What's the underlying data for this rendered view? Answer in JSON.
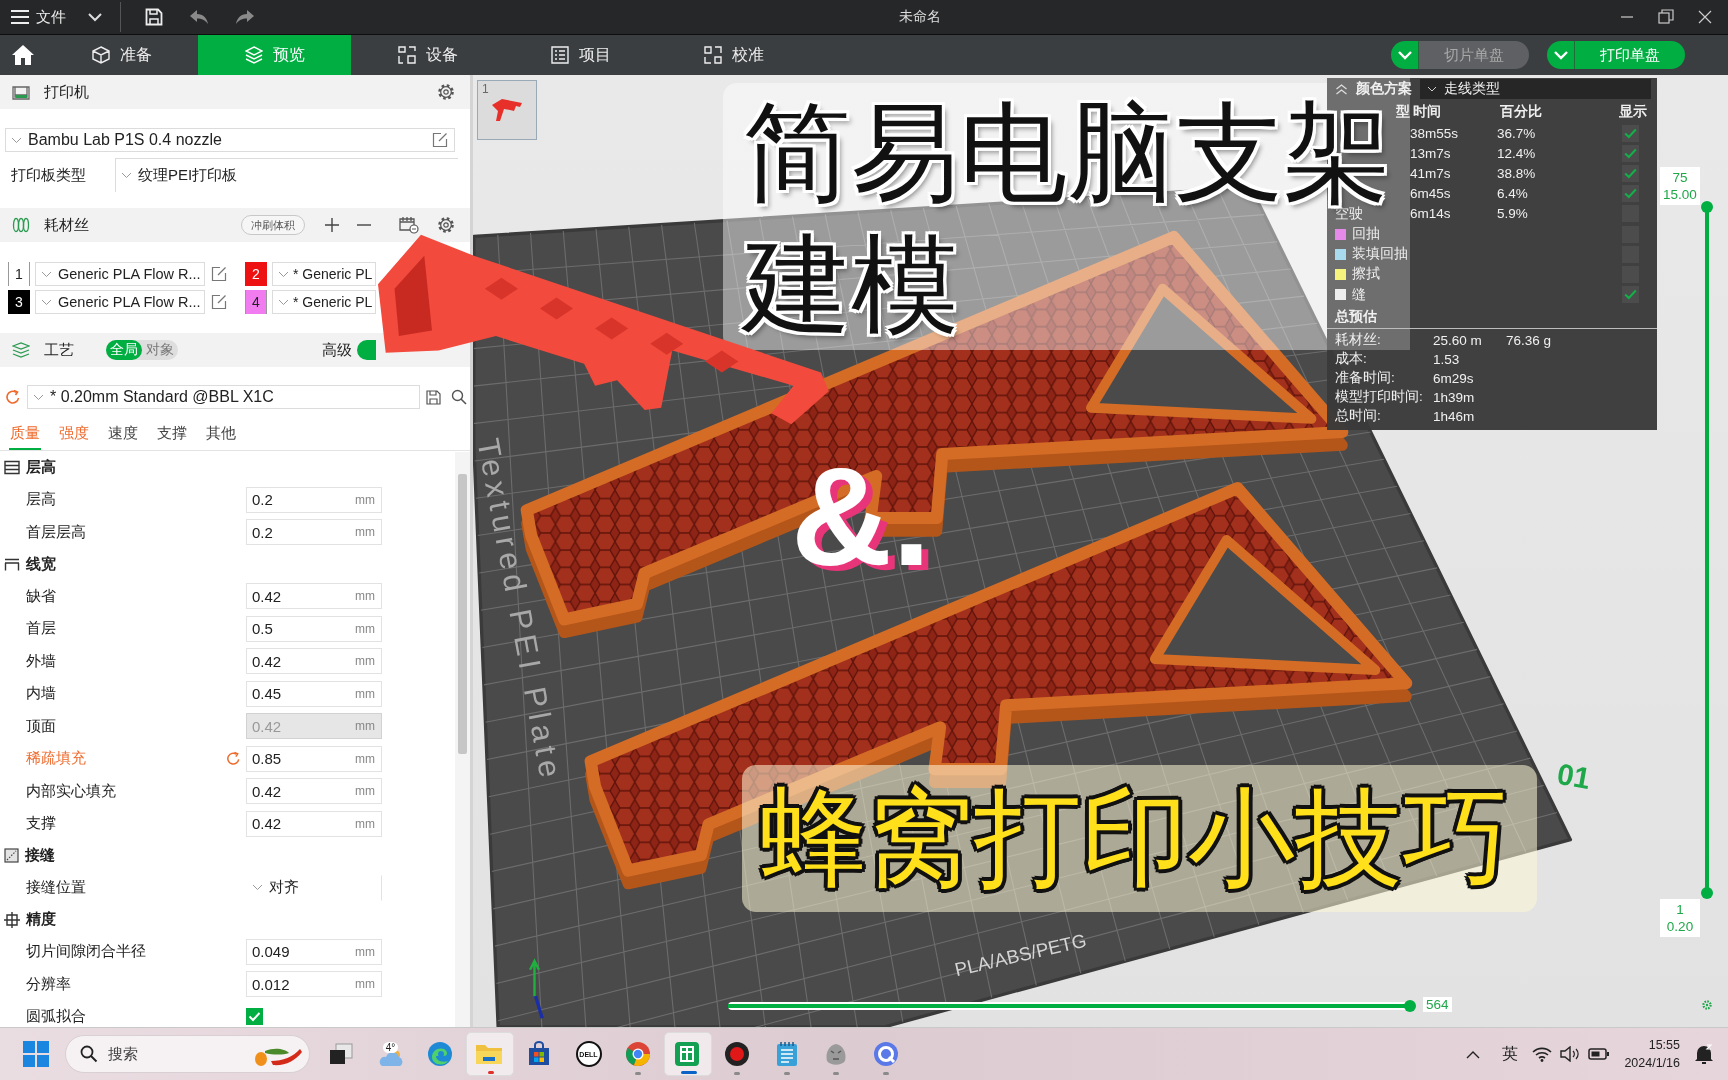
{
  "title_bar": {
    "menu": "文件",
    "title": "未命名"
  },
  "nav": {
    "tabs": [
      {
        "label": "准备",
        "selected": false
      },
      {
        "label": "预览",
        "selected": true
      },
      {
        "label": "设备",
        "selected": false
      },
      {
        "label": "项目",
        "selected": false
      },
      {
        "label": "校准",
        "selected": false
      }
    ],
    "actions": [
      {
        "label": "切片单盘",
        "disabled": true
      },
      {
        "label": "打印单盘",
        "disabled": false
      }
    ]
  },
  "printer": {
    "heading": "打印机",
    "preset": "Bambu Lab P1S 0.4 nozzle",
    "plate_type_label": "打印板类型",
    "plate_type": "纹理PEI打印板"
  },
  "filament": {
    "heading": "耗材丝",
    "flush_button": "冲刷体积",
    "slots": [
      {
        "number": "1",
        "color": "#ffffff",
        "name": "Generic PLA Flow R..."
      },
      {
        "number": "2",
        "color": "#ee1111",
        "name": "* Generic PL"
      },
      {
        "number": "3",
        "color": "#000000",
        "name": "Generic PLA Flow R..."
      },
      {
        "number": "4",
        "color": "#f07cf0",
        "name": "* Generic PL"
      }
    ]
  },
  "process": {
    "heading": "工艺",
    "scope": [
      {
        "label": "全局",
        "selected": true
      },
      {
        "label": "对象",
        "selected": false
      }
    ],
    "advanced_label": "高级",
    "advanced": true,
    "preset": "* 0.20mm Standard @BBL X1C",
    "tabs": [
      {
        "label": "质量",
        "selected": true,
        "modified": true
      },
      {
        "label": "强度",
        "selected": false,
        "modified": true
      },
      {
        "label": "速度",
        "selected": false,
        "modified": false
      },
      {
        "label": "支撑",
        "selected": false,
        "modified": false
      },
      {
        "label": "其他",
        "selected": false,
        "modified": false
      }
    ]
  },
  "settings": [
    {
      "heading": "层高",
      "items": [
        {
          "kind": "number",
          "label": "层高",
          "value": "0.2",
          "unit": "mm",
          "modified": false,
          "disabled": false
        },
        {
          "kind": "number",
          "label": "首层层高",
          "value": "0.2",
          "unit": "mm",
          "modified": false,
          "disabled": false
        }
      ]
    },
    {
      "heading": "线宽",
      "items": [
        {
          "kind": "number",
          "label": "缺省",
          "value": "0.42",
          "unit": "mm",
          "modified": false,
          "disabled": false
        },
        {
          "kind": "number",
          "label": "首层",
          "value": "0.5",
          "unit": "mm",
          "modified": false,
          "disabled": false
        },
        {
          "kind": "number",
          "label": "外墙",
          "value": "0.42",
          "unit": "mm",
          "modified": false,
          "disabled": false
        },
        {
          "kind": "number",
          "label": "内墙",
          "value": "0.45",
          "unit": "mm",
          "modified": false,
          "disabled": false
        },
        {
          "kind": "number",
          "label": "顶面",
          "value": "0.42",
          "unit": "mm",
          "modified": false,
          "disabled": true
        },
        {
          "kind": "number",
          "label": "稀疏填充",
          "value": "0.85",
          "unit": "mm",
          "modified": true,
          "disabled": false
        },
        {
          "kind": "number",
          "label": "内部实心填充",
          "value": "0.42",
          "unit": "mm",
          "modified": false,
          "disabled": false
        },
        {
          "kind": "number",
          "label": "支撑",
          "value": "0.42",
          "unit": "mm",
          "modified": false,
          "disabled": false
        }
      ]
    },
    {
      "heading": "接缝",
      "items": [
        {
          "kind": "select",
          "label": "接缝位置",
          "value": "对齐",
          "modified": false,
          "disabled": false
        }
      ]
    },
    {
      "heading": "精度",
      "items": [
        {
          "kind": "number",
          "label": "切片间隙闭合半径",
          "value": "0.049",
          "unit": "mm",
          "modified": false,
          "disabled": false
        },
        {
          "kind": "number",
          "label": "分辨率",
          "value": "0.012",
          "unit": "mm",
          "modified": false,
          "disabled": false
        },
        {
          "kind": "checkbox",
          "label": "圆弧拟合",
          "checked": true,
          "modified": false,
          "disabled": false
        }
      ]
    }
  ],
  "viewport": {
    "plate_thumbnail": "1",
    "plate": {
      "number": "01",
      "texts": [
        "Textured PEI Plate",
        "PLA/ABS/PETG"
      ]
    },
    "legend": {
      "heading": "颜色方案",
      "expanded": true,
      "scheme": "走线类型",
      "columns": [
        "型",
        "时间",
        "百分比",
        "显示"
      ],
      "rows": [
        {
          "time": "38m55s",
          "percent": "36.7%",
          "shown": true
        },
        {
          "time": "13m7s",
          "percent": "12.4%",
          "shown": true
        },
        {
          "time": "41m7s",
          "percent": "38.8%",
          "shown": true
        },
        {
          "time": "6m45s",
          "percent": "6.4%",
          "shown": true
        },
        {
          "name": "空驶",
          "time": "6m14s",
          "percent": "5.9%",
          "shown": false
        },
        {
          "name": "回抽",
          "color": "#e58ae8",
          "shown": false
        },
        {
          "name": "装填回抽",
          "color": "#a9dbee",
          "shown": false
        },
        {
          "name": "擦拭",
          "color": "#f6f27e",
          "shown": false
        },
        {
          "name": "缝",
          "color": "#eeeeee",
          "shown": true
        }
      ],
      "summary_heading": "总预估",
      "summary": [
        {
          "label": "耗材丝:",
          "values": [
            "25.60 m",
            "76.36 g"
          ]
        },
        {
          "label": "成本:",
          "values": [
            "1.53"
          ]
        },
        {
          "label": "准备时间:",
          "values": [
            "6m29s"
          ]
        },
        {
          "label": "模型打印时间:",
          "values": [
            "1h39m"
          ]
        },
        {
          "label": "总时间:",
          "values": [
            "1h46m"
          ]
        }
      ]
    },
    "layer_slider": {
      "upper": [
        "75",
        "15.00"
      ],
      "lower": [
        "1",
        "0.20"
      ],
      "level": 1
    },
    "move_slider": {
      "reading": "564",
      "level": 1
    },
    "overlay": {
      "title_lines": [
        "简易电脑支架",
        "建模"
      ],
      "mark": "&.",
      "subtitle": "蜂窝打印小技巧"
    }
  },
  "taskbar": {
    "search_placeholder": "搜索",
    "apps": [
      {
        "kind": "taskview",
        "running": false,
        "selected": false,
        "flashing": false
      },
      {
        "kind": "weather",
        "label": "4°",
        "running": false,
        "selected": false,
        "flashing": false
      },
      {
        "kind": "swirl",
        "running": false,
        "selected": false,
        "flashing": false
      },
      {
        "kind": "folder",
        "running": true,
        "selected": false,
        "flashing": true
      },
      {
        "kind": "store",
        "running": false,
        "selected": false,
        "flashing": false
      },
      {
        "kind": "logo",
        "label": "DELL",
        "running": false,
        "selected": false,
        "flashing": false
      },
      {
        "kind": "globe",
        "running": true,
        "selected": false,
        "flashing": false
      },
      {
        "kind": "sheet",
        "running": true,
        "selected": true,
        "flashing": false
      },
      {
        "kind": "record",
        "running": true,
        "selected": false,
        "flashing": false
      },
      {
        "kind": "notepad",
        "running": true,
        "selected": false,
        "flashing": false
      },
      {
        "kind": "animal",
        "running": true,
        "selected": false,
        "flashing": false
      },
      {
        "kind": "ring",
        "running": true,
        "selected": false,
        "flashing": false
      }
    ],
    "tray": {
      "ime": "英",
      "time": "15:55",
      "date": "2024/1/16"
    }
  }
}
